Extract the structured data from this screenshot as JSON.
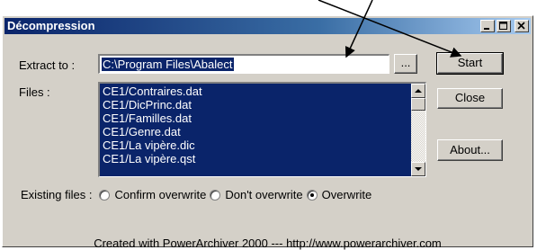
{
  "window": {
    "title": "Décompression",
    "controls": [
      "minimize-icon",
      "maximize-icon",
      "close-icon"
    ]
  },
  "extract": {
    "label": "Extract to :",
    "value": "C:\\Program Files\\Abalect",
    "browse_label": "..."
  },
  "files": {
    "label": "Files :",
    "items": [
      "CE1/Contraires.dat",
      "CE1/DicPrinc.dat",
      "CE1/Familles.dat",
      "CE1/Genre.dat",
      "CE1/La vipère.dic",
      "CE1/La vipère.qst"
    ]
  },
  "buttons": {
    "start": "Start",
    "close": "Close",
    "about": "About..."
  },
  "existing": {
    "label": "Existing files :",
    "options": [
      {
        "label": "Confirm overwrite",
        "checked": false
      },
      {
        "label": "Don't overwrite",
        "checked": false
      },
      {
        "label": "Overwrite",
        "checked": true
      }
    ]
  },
  "footer": "Created with PowerArchiver 2000 --- http://www.powerarchiver.com"
}
